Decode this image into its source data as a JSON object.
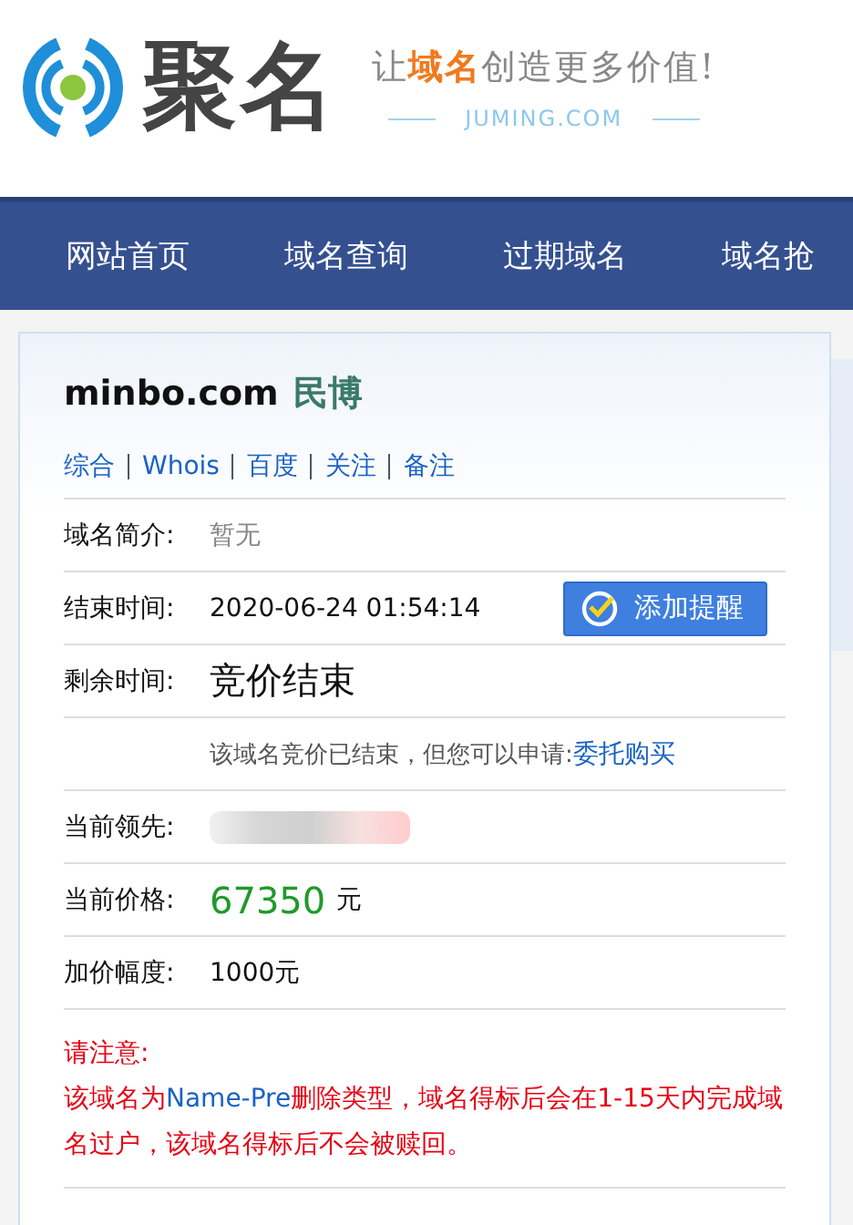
{
  "logo": {
    "name": "聚名",
    "slogan": [
      {
        "text": "让",
        "kind": "plain"
      },
      {
        "text": "域名",
        "kind": "accent"
      },
      {
        "text": "创造更多价值!",
        "kind": "plain"
      }
    ],
    "site": "JUMING.COM"
  },
  "nav": [
    {
      "label": "网站首页"
    },
    {
      "label": "域名查询"
    },
    {
      "label": "过期域名"
    },
    {
      "label": "域名抢"
    }
  ],
  "domain": {
    "name": "minbo.com",
    "meaning": "民博"
  },
  "links": [
    "综合",
    "Whois",
    "百度",
    "关注",
    "备注"
  ],
  "rows": [
    {
      "kind": "muted",
      "label": "域名简介:",
      "value": "暂无"
    },
    {
      "kind": "datetime",
      "label": "结束时间:",
      "value": "2020-06-24 01:54:14",
      "button": "添加提醒"
    },
    {
      "kind": "big",
      "label": "剩余时间:",
      "value": "竞价结束"
    },
    {
      "kind": "note",
      "text": "该域名竞价已结束，但您可以申请:",
      "link": "委托购买"
    },
    {
      "kind": "hidden",
      "label": "当前领先:"
    },
    {
      "kind": "price",
      "label": "当前价格:",
      "value": "67350",
      "unit": "元"
    },
    {
      "kind": "plain",
      "label": "加价幅度:",
      "value": "1000元"
    }
  ],
  "notice": {
    "title": "请注意:",
    "parts": [
      {
        "text": "该域名为",
        "kind": "plain"
      },
      {
        "text": "Name-Pre",
        "kind": "highlight"
      },
      {
        "text": "删除类型，域名得标后会在1-15天内完成域名过户，该域名得标后不会被赎回。",
        "kind": "plain"
      }
    ]
  }
}
